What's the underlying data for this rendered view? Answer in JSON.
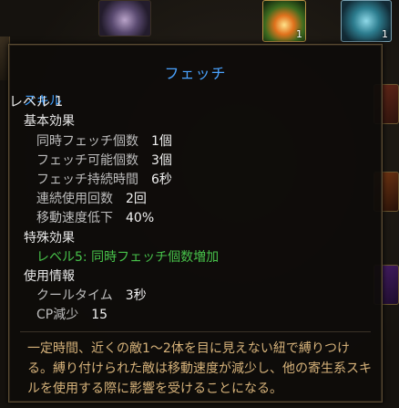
{
  "tooltip": {
    "title": "フェッチ",
    "skill_label": "スキル",
    "level": "レベル 1",
    "basic_effects_header": "基本効果",
    "basic_effects": [
      {
        "label": "同時フェッチ個数",
        "value": "1個"
      },
      {
        "label": "フェッチ可能個数",
        "value": "3個"
      },
      {
        "label": "フェッチ持続時間",
        "value": "6秒"
      },
      {
        "label": "連続使用回数",
        "value": "2回"
      },
      {
        "label": "移動速度低下",
        "value": "40%"
      }
    ],
    "special_effects_header": "特殊効果",
    "special_effect": "レベル5: 同時フェッチ個数増加",
    "usage_header": "使用情報",
    "usage": [
      {
        "label": "クールタイム",
        "value": "3秒"
      },
      {
        "label": "CP減少",
        "value": "15"
      }
    ],
    "description": "一定時間、近くの敵1～2体を目に見えない紐で縛りつける。縛り付けられた敵は移動速度が減少し、他の寄生系スキルを使用する際に影響を受けることになる。"
  },
  "background": {
    "slot_badge_1": "1",
    "slot_badge_2": "1"
  }
}
